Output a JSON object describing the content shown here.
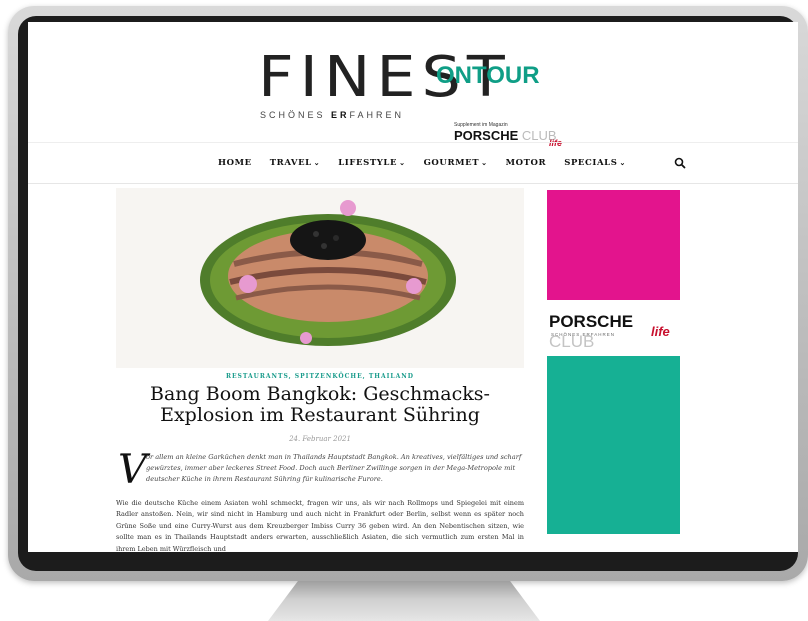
{
  "site": {
    "logo_main": "FINEST",
    "logo_accent": "ONTOUR",
    "tagline_pre": "SCHÖNES ",
    "tagline_bold": "ER",
    "tagline_post": "FAHREN",
    "supplement": "Supplement im Magazin",
    "porsche": "PORSCHE",
    "club": "CLUB",
    "life": "life"
  },
  "nav": {
    "items": [
      {
        "label": "HOME",
        "dropdown": false
      },
      {
        "label": "TRAVEL",
        "dropdown": true
      },
      {
        "label": "LIFESTYLE",
        "dropdown": true
      },
      {
        "label": "GOURMET",
        "dropdown": true
      },
      {
        "label": "MOTOR",
        "dropdown": false
      },
      {
        "label": "SPECIALS",
        "dropdown": true
      }
    ],
    "search_icon": "search-icon"
  },
  "article": {
    "categories": "RESTAURANTS, SPITZENKÖCHE, THAILAND",
    "title": "Bang Boom Bangkok: Geschmacks-Explosion im Restaurant Sühring",
    "date": "24. Februar 2021",
    "dropcap": "V",
    "lead": "or allem an kleine Garküchen denkt man in Thailands Hauptstadt Bangkok. An kreatives, vielfältiges und scharf gewürztes, immer aber leckeres Street Food. Doch auch Berliner Zwillinge sorgen in der Mega-Metropole mit deutscher Küche in ihrem Restaurant Sühring für kulinarische Furore.",
    "body": "Wie die deutsche Küche einem Asiaten wohl schmeckt, fragen wir uns, als wir nach Rollmops und Spiegelei mit einem Radler anstoßen. Nein, wir sind nicht in Hamburg und auch nicht in Frankfurt oder Berlin, selbst wenn es später noch Grüne Soße und eine Curry-Wurst aus dem Kreuzberger Imbiss Curry 36 geben wird. An den Nebentischen sitzen, wie sollte man es in Thailands Hauptstadt anders erwarten, ausschließlich Asiaten, die sich vermutlich zum ersten Mal in ihrem Leben mit Würzfleisch und"
  },
  "sidebar": {
    "porsche": "PORSCHE",
    "club": "CLUB",
    "life": "life",
    "tagline": "SCHÖNES ERFAHREN"
  },
  "colors": {
    "accent": "#0f9e86",
    "magenta_ad": "#e3148d",
    "teal_ad": "#16b094",
    "porsche_red": "#c8102e"
  }
}
